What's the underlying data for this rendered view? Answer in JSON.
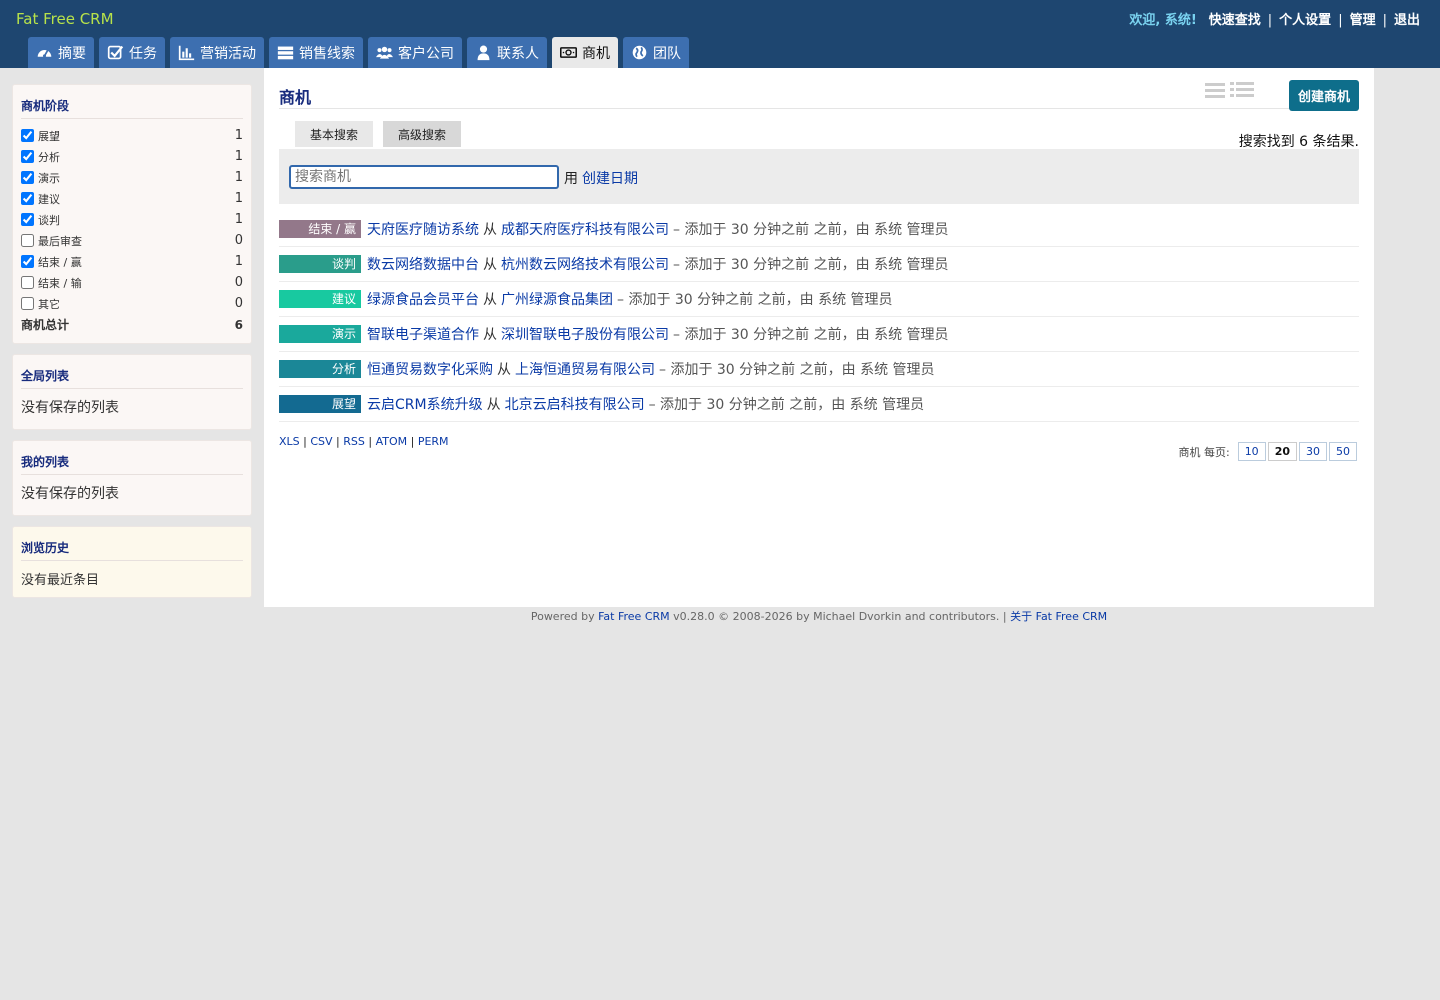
{
  "header": {
    "brand": "Fat Free CRM",
    "welcome": "欢迎, 系统!",
    "links": [
      "快速查找",
      "个人设置",
      "管理",
      "退出"
    ]
  },
  "tabs": [
    {
      "label": "摘要",
      "icon": "dashboard-icon",
      "active": false
    },
    {
      "label": "任务",
      "icon": "check-square-icon",
      "active": false
    },
    {
      "label": "营销活动",
      "icon": "bar-chart-icon",
      "active": false
    },
    {
      "label": "销售线索",
      "icon": "server-icon",
      "active": false
    },
    {
      "label": "客户公司",
      "icon": "users-icon",
      "active": false
    },
    {
      "label": "联系人",
      "icon": "user-icon",
      "active": false
    },
    {
      "label": "商机",
      "icon": "money-icon",
      "active": true
    },
    {
      "label": "团队",
      "icon": "globe-icon",
      "active": false
    }
  ],
  "sidebar": {
    "stages_title": "商机阶段",
    "stages": [
      {
        "label": "展望",
        "count": "1",
        "checked": true
      },
      {
        "label": "分析",
        "count": "1",
        "checked": true
      },
      {
        "label": "演示",
        "count": "1",
        "checked": true
      },
      {
        "label": "建议",
        "count": "1",
        "checked": true
      },
      {
        "label": "谈判",
        "count": "1",
        "checked": true
      },
      {
        "label": "最后审查",
        "count": "0",
        "checked": false
      },
      {
        "label": "结束 / 赢",
        "count": "1",
        "checked": true
      },
      {
        "label": "结束 / 输",
        "count": "0",
        "checked": false
      },
      {
        "label": "其它",
        "count": "0",
        "checked": false
      }
    ],
    "total_label": "商机总计",
    "total": "6",
    "global_lists_title": "全局列表",
    "global_lists_empty": "没有保存的列表",
    "my_lists_title": "我的列表",
    "my_lists_empty": "没有保存的列表",
    "history_title": "浏览历史",
    "history_empty": "没有最近条目"
  },
  "main": {
    "title": "商机",
    "create_button": "创建商机",
    "basic_search": "基本搜索",
    "advanced_search": "高级搜索",
    "result_count": "搜索找到 6 条结果.",
    "search_placeholder": "搜索商机",
    "search_by": "用",
    "search_by_link": "创建日期"
  },
  "opportunities": [
    {
      "stage": "结束 / 赢",
      "color": "#93788a",
      "name": "天府医疗随访系统",
      "from": "从",
      "account": "成都天府医疗科技有限公司",
      "meta": "– 添加于 30 分钟之前 之前，由 系统 管理员"
    },
    {
      "stage": "谈判",
      "color": "#2a9d8b",
      "name": "数云网络数据中台",
      "from": "从",
      "account": "杭州数云网络技术有限公司",
      "meta": "– 添加于 30 分钟之前 之前，由 系统 管理员"
    },
    {
      "stage": "建议",
      "color": "#18c9a0",
      "name": "绿源食品会员平台",
      "from": "从",
      "account": "广州绿源食品集团",
      "meta": "– 添加于 30 分钟之前 之前，由 系统 管理员"
    },
    {
      "stage": "演示",
      "color": "#1aa99c",
      "name": "智联电子渠道合作",
      "from": "从",
      "account": "深圳智联电子股份有限公司",
      "meta": "– 添加于 30 分钟之前 之前，由 系统 管理员"
    },
    {
      "stage": "分析",
      "color": "#1b8797",
      "name": "恒通贸易数字化采购",
      "from": "从",
      "account": "上海恒通贸易有限公司",
      "meta": "– 添加于 30 分钟之前 之前，由 系统 管理员"
    },
    {
      "stage": "展望",
      "color": "#136a91",
      "name": "云启CRM系统升级",
      "from": "从",
      "account": "北京云启科技有限公司",
      "meta": "– 添加于 30 分钟之前 之前，由 系统 管理员"
    }
  ],
  "exports": [
    "XLS",
    "CSV",
    "RSS",
    "ATOM",
    "PERM"
  ],
  "per_page": {
    "label": "商机 每页:",
    "options": [
      "10",
      "20",
      "30",
      "50"
    ],
    "current": "20"
  },
  "footer": {
    "prefix": "Powered by",
    "crm_link": "Fat Free CRM",
    "middle": "v0.28.0 © 2008-2026 by Michael Dvorkin and contributors. |",
    "about_link": "关于 Fat Free CRM"
  }
}
